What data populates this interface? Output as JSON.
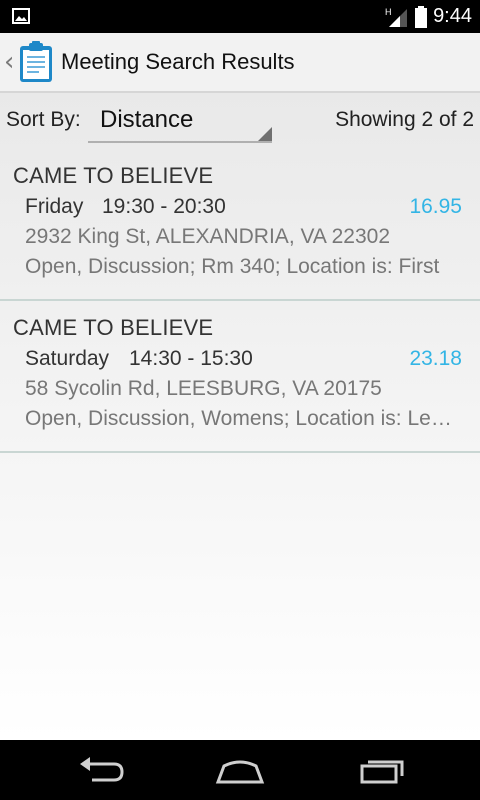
{
  "status_bar": {
    "time": "9:44",
    "network_indicator": "H",
    "icons": [
      "image-notification-icon",
      "signal-icon",
      "battery-icon"
    ]
  },
  "action_bar": {
    "title": "Meeting Search Results",
    "icon": "clipboard-icon"
  },
  "sort": {
    "label": "Sort By:",
    "selected": "Distance",
    "showing": "Showing 2 of 2"
  },
  "meetings": [
    {
      "name": "CAME TO BELIEVE",
      "day": "Friday",
      "time": "19:30 - 20:30",
      "distance": "16.95",
      "address": "2932 King St, ALEXANDRIA, VA 22302",
      "notes": "Open, Discussion; Rm 340; Location is: First"
    },
    {
      "name": "CAME TO BELIEVE",
      "day": "Saturday",
      "time": "14:30 - 15:30",
      "distance": "23.18",
      "address": "58 Sycolin Rd, LEESBURG, VA 20175",
      "notes": "Open, Discussion, Womens; Location is: Leesburg"
    }
  ],
  "colors": {
    "accent": "#33b5e5",
    "action_bar_bg": "#f2f2f2",
    "nav_bar_bg": "#000000"
  },
  "nav_bar": {
    "icons": [
      "back-icon",
      "home-icon",
      "recent-apps-icon"
    ]
  }
}
